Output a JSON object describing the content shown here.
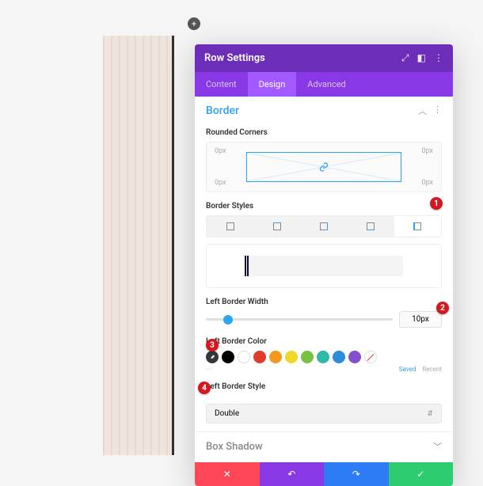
{
  "modal": {
    "title": "Row Settings",
    "tabs": [
      "Content",
      "Design",
      "Advanced"
    ],
    "active_tab": "Design"
  },
  "border": {
    "section_title": "Border",
    "rounded_label": "Rounded Corners",
    "corners": {
      "tl": "0px",
      "tr": "0px",
      "bl": "0px",
      "br": "0px"
    },
    "styles_label": "Border Styles",
    "left_width_label": "Left Border Width",
    "left_width_value": "10px",
    "left_color_label": "Left Border Color",
    "colors": {
      "black": "#000000",
      "white": "#ffffff",
      "red": "#e13b2b",
      "orange": "#f19a1f",
      "yellow": "#ecd925",
      "green": "#78c146",
      "teal": "#2fb9a8",
      "blue": "#2c8dd8",
      "purple": "#8350c9"
    },
    "color_links": {
      "more": "···",
      "saved": "Saved",
      "recent": "Recent"
    },
    "left_style_label": "Left Border Style",
    "left_style_value": "Double"
  },
  "box_shadow": {
    "title": "Box Shadow"
  },
  "markers": {
    "m1": "1",
    "m2": "2",
    "m3": "3",
    "m4": "4"
  }
}
